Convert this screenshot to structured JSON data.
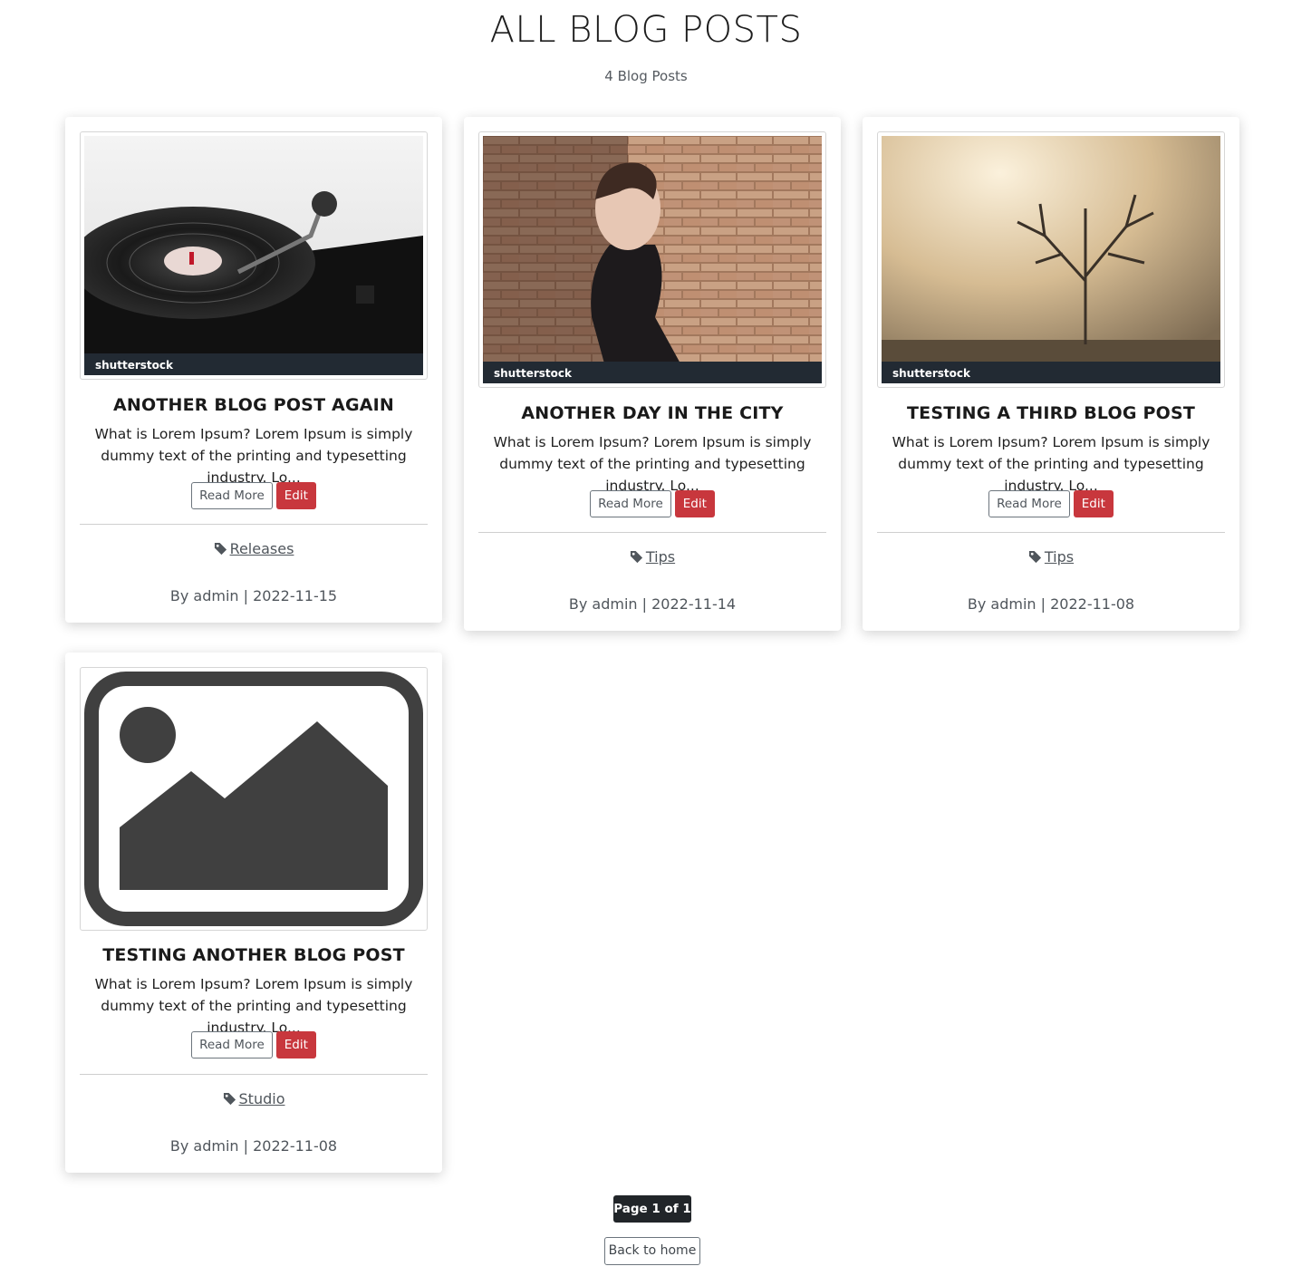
{
  "header": {
    "title": "ALL BLOG POSTS",
    "count": "4 Blog Posts"
  },
  "posts": [
    {
      "image": "record-player-photo",
      "title": "ANOTHER BLOG POST AGAIN",
      "excerpt": "What is Lorem Ipsum? Lorem Ipsum is simply dummy text of the printing and typesetting industry. Lo...",
      "read_more": "Read More",
      "edit": "Edit",
      "tag": "Releases",
      "byline": "By admin | 2022-11-15",
      "watermark": "shutterstock"
    },
    {
      "image": "woman-brick-wall-photo",
      "title": "ANOTHER DAY IN THE CITY",
      "excerpt": "What is Lorem Ipsum? Lorem Ipsum is simply dummy text of the printing and typesetting industry. Lo...",
      "read_more": "Read More",
      "edit": "Edit",
      "tag": "Tips",
      "byline": "By admin | 2022-11-14",
      "watermark": "shutterstock"
    },
    {
      "image": "foggy-tree-photo",
      "title": "TESTING A THIRD BLOG POST",
      "excerpt": "What is Lorem Ipsum? Lorem Ipsum is simply dummy text of the printing and typesetting industry. Lo...",
      "read_more": "Read More",
      "edit": "Edit",
      "tag": "Tips",
      "byline": "By admin | 2022-11-08",
      "watermark": "shutterstock"
    },
    {
      "image": "image-placeholder-icon",
      "title": "TESTING ANOTHER BLOG POST",
      "excerpt": "What is Lorem Ipsum? Lorem Ipsum is simply dummy text of the printing and typesetting industry. Lo...",
      "read_more": "Read More",
      "edit": "Edit",
      "tag": "Studio",
      "byline": "By admin | 2022-11-08"
    }
  ],
  "pagination": {
    "label": "Page 1 of 1"
  },
  "footer": {
    "back_label": "Back to home"
  },
  "colors": {
    "edit_button": "#c8373d",
    "pager_bg": "#212529",
    "muted_text": "#50565c"
  }
}
